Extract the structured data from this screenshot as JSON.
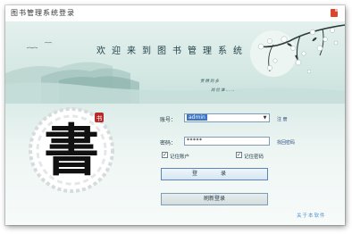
{
  "window": {
    "title": "图书管理系统登录"
  },
  "banner": {
    "welcome": "欢迎来到图书管理系统",
    "poem_line1": "贵精则多",
    "poem_line2": "尚俭谁……"
  },
  "logo": {
    "glyph": "書",
    "seal_text": "书"
  },
  "form": {
    "account_label": "账号：",
    "account_value": "admin",
    "register_link": "注 册",
    "password_label": "密码：",
    "password_value": "*****",
    "retrieve_link": "找回密码",
    "remember_account": "记住账户",
    "remember_password": "记住密码",
    "remember_account_checked": true,
    "remember_password_checked": true,
    "login_button": "登 录",
    "refresh_button": "刷新登录",
    "about_link": "关于本软件"
  },
  "colors": {
    "accent": "#3a74c5",
    "close": "#d9472b",
    "link": "#4f8fcf"
  }
}
